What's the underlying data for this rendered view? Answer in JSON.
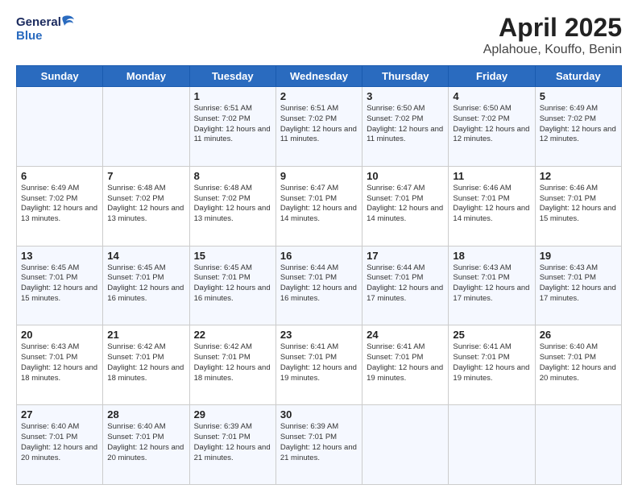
{
  "header": {
    "logo_general": "General",
    "logo_blue": "Blue",
    "title": "April 2025",
    "subtitle": "Aplahoue, Kouffo, Benin"
  },
  "calendar": {
    "days_of_week": [
      "Sunday",
      "Monday",
      "Tuesday",
      "Wednesday",
      "Thursday",
      "Friday",
      "Saturday"
    ],
    "weeks": [
      [
        {
          "day": "",
          "info": ""
        },
        {
          "day": "",
          "info": ""
        },
        {
          "day": "1",
          "info": "Sunrise: 6:51 AM\nSunset: 7:02 PM\nDaylight: 12 hours and 11 minutes."
        },
        {
          "day": "2",
          "info": "Sunrise: 6:51 AM\nSunset: 7:02 PM\nDaylight: 12 hours and 11 minutes."
        },
        {
          "day": "3",
          "info": "Sunrise: 6:50 AM\nSunset: 7:02 PM\nDaylight: 12 hours and 11 minutes."
        },
        {
          "day": "4",
          "info": "Sunrise: 6:50 AM\nSunset: 7:02 PM\nDaylight: 12 hours and 12 minutes."
        },
        {
          "day": "5",
          "info": "Sunrise: 6:49 AM\nSunset: 7:02 PM\nDaylight: 12 hours and 12 minutes."
        }
      ],
      [
        {
          "day": "6",
          "info": "Sunrise: 6:49 AM\nSunset: 7:02 PM\nDaylight: 12 hours and 13 minutes."
        },
        {
          "day": "7",
          "info": "Sunrise: 6:48 AM\nSunset: 7:02 PM\nDaylight: 12 hours and 13 minutes."
        },
        {
          "day": "8",
          "info": "Sunrise: 6:48 AM\nSunset: 7:02 PM\nDaylight: 12 hours and 13 minutes."
        },
        {
          "day": "9",
          "info": "Sunrise: 6:47 AM\nSunset: 7:01 PM\nDaylight: 12 hours and 14 minutes."
        },
        {
          "day": "10",
          "info": "Sunrise: 6:47 AM\nSunset: 7:01 PM\nDaylight: 12 hours and 14 minutes."
        },
        {
          "day": "11",
          "info": "Sunrise: 6:46 AM\nSunset: 7:01 PM\nDaylight: 12 hours and 14 minutes."
        },
        {
          "day": "12",
          "info": "Sunrise: 6:46 AM\nSunset: 7:01 PM\nDaylight: 12 hours and 15 minutes."
        }
      ],
      [
        {
          "day": "13",
          "info": "Sunrise: 6:45 AM\nSunset: 7:01 PM\nDaylight: 12 hours and 15 minutes."
        },
        {
          "day": "14",
          "info": "Sunrise: 6:45 AM\nSunset: 7:01 PM\nDaylight: 12 hours and 16 minutes."
        },
        {
          "day": "15",
          "info": "Sunrise: 6:45 AM\nSunset: 7:01 PM\nDaylight: 12 hours and 16 minutes."
        },
        {
          "day": "16",
          "info": "Sunrise: 6:44 AM\nSunset: 7:01 PM\nDaylight: 12 hours and 16 minutes."
        },
        {
          "day": "17",
          "info": "Sunrise: 6:44 AM\nSunset: 7:01 PM\nDaylight: 12 hours and 17 minutes."
        },
        {
          "day": "18",
          "info": "Sunrise: 6:43 AM\nSunset: 7:01 PM\nDaylight: 12 hours and 17 minutes."
        },
        {
          "day": "19",
          "info": "Sunrise: 6:43 AM\nSunset: 7:01 PM\nDaylight: 12 hours and 17 minutes."
        }
      ],
      [
        {
          "day": "20",
          "info": "Sunrise: 6:43 AM\nSunset: 7:01 PM\nDaylight: 12 hours and 18 minutes."
        },
        {
          "day": "21",
          "info": "Sunrise: 6:42 AM\nSunset: 7:01 PM\nDaylight: 12 hours and 18 minutes."
        },
        {
          "day": "22",
          "info": "Sunrise: 6:42 AM\nSunset: 7:01 PM\nDaylight: 12 hours and 18 minutes."
        },
        {
          "day": "23",
          "info": "Sunrise: 6:41 AM\nSunset: 7:01 PM\nDaylight: 12 hours and 19 minutes."
        },
        {
          "day": "24",
          "info": "Sunrise: 6:41 AM\nSunset: 7:01 PM\nDaylight: 12 hours and 19 minutes."
        },
        {
          "day": "25",
          "info": "Sunrise: 6:41 AM\nSunset: 7:01 PM\nDaylight: 12 hours and 19 minutes."
        },
        {
          "day": "26",
          "info": "Sunrise: 6:40 AM\nSunset: 7:01 PM\nDaylight: 12 hours and 20 minutes."
        }
      ],
      [
        {
          "day": "27",
          "info": "Sunrise: 6:40 AM\nSunset: 7:01 PM\nDaylight: 12 hours and 20 minutes."
        },
        {
          "day": "28",
          "info": "Sunrise: 6:40 AM\nSunset: 7:01 PM\nDaylight: 12 hours and 20 minutes."
        },
        {
          "day": "29",
          "info": "Sunrise: 6:39 AM\nSunset: 7:01 PM\nDaylight: 12 hours and 21 minutes."
        },
        {
          "day": "30",
          "info": "Sunrise: 6:39 AM\nSunset: 7:01 PM\nDaylight: 12 hours and 21 minutes."
        },
        {
          "day": "",
          "info": ""
        },
        {
          "day": "",
          "info": ""
        },
        {
          "day": "",
          "info": ""
        }
      ]
    ]
  }
}
